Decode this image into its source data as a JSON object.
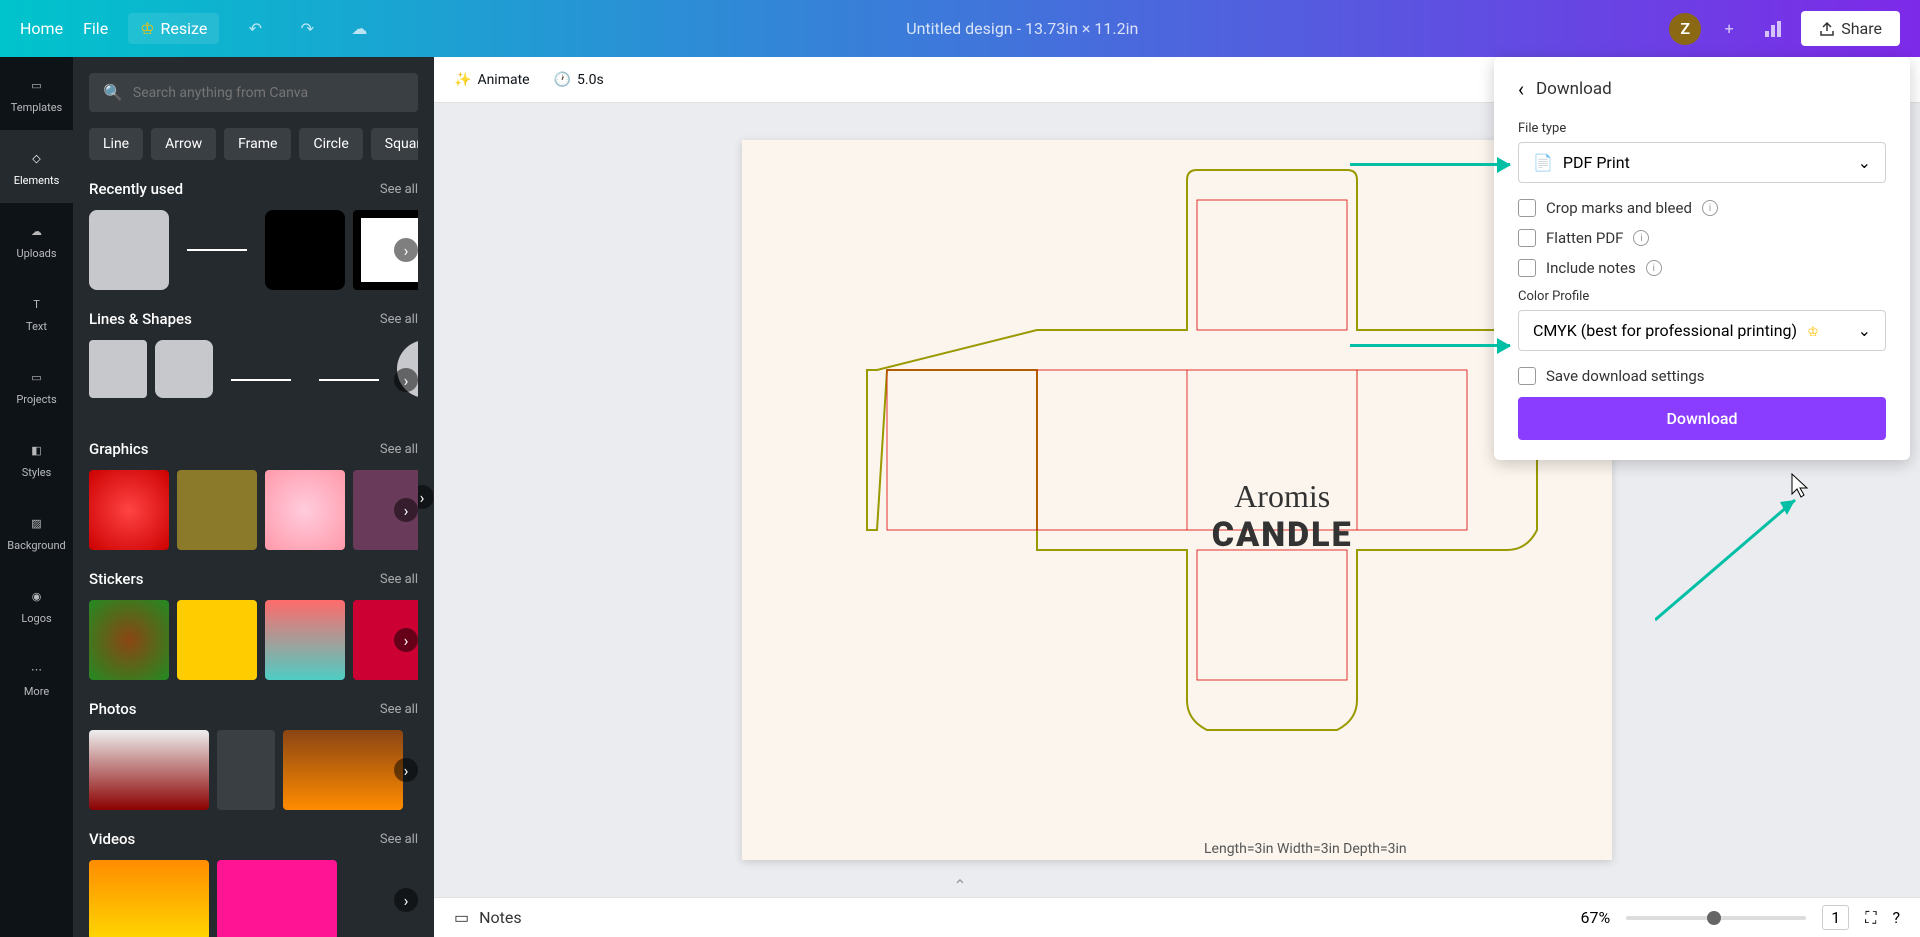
{
  "topbar": {
    "home": "Home",
    "file": "File",
    "resize": "Resize",
    "title": "Untitled design - 13.73in × 11.2in",
    "avatar_letter": "Z",
    "share": "Share"
  },
  "leftnav": {
    "items": [
      {
        "label": "Templates",
        "icon": "templates"
      },
      {
        "label": "Elements",
        "icon": "elements"
      },
      {
        "label": "Uploads",
        "icon": "uploads"
      },
      {
        "label": "Text",
        "icon": "text"
      },
      {
        "label": "Projects",
        "icon": "projects"
      },
      {
        "label": "Styles",
        "icon": "styles"
      },
      {
        "label": "Background",
        "icon": "background"
      },
      {
        "label": "Logos",
        "icon": "logos"
      },
      {
        "label": "More",
        "icon": "more"
      }
    ]
  },
  "sidepanel": {
    "search_placeholder": "Search anything from Canva",
    "chips": [
      "Line",
      "Arrow",
      "Frame",
      "Circle",
      "Square"
    ],
    "sections": {
      "recently_used": "Recently used",
      "lines_shapes": "Lines & Shapes",
      "graphics": "Graphics",
      "stickers": "Stickers",
      "photos": "Photos",
      "videos": "Videos"
    },
    "see_all": "See all"
  },
  "canvas": {
    "animate": "Animate",
    "duration": "5.0s",
    "brand_script": "Aromis",
    "brand_bold": "CANDLE",
    "dims": "Length=3in Width=3in Depth=3in"
  },
  "download": {
    "title": "Download",
    "file_type_label": "File type",
    "file_type_value": "PDF Print",
    "crop_marks": "Crop marks and bleed",
    "flatten_pdf": "Flatten PDF",
    "include_notes": "Include notes",
    "color_profile_label": "Color Profile",
    "color_profile_value": "CMYK (best for professional printing)",
    "save_settings": "Save download settings",
    "download_button": "Download"
  },
  "bottombar": {
    "notes": "Notes",
    "zoom": "67%",
    "page": "1"
  }
}
